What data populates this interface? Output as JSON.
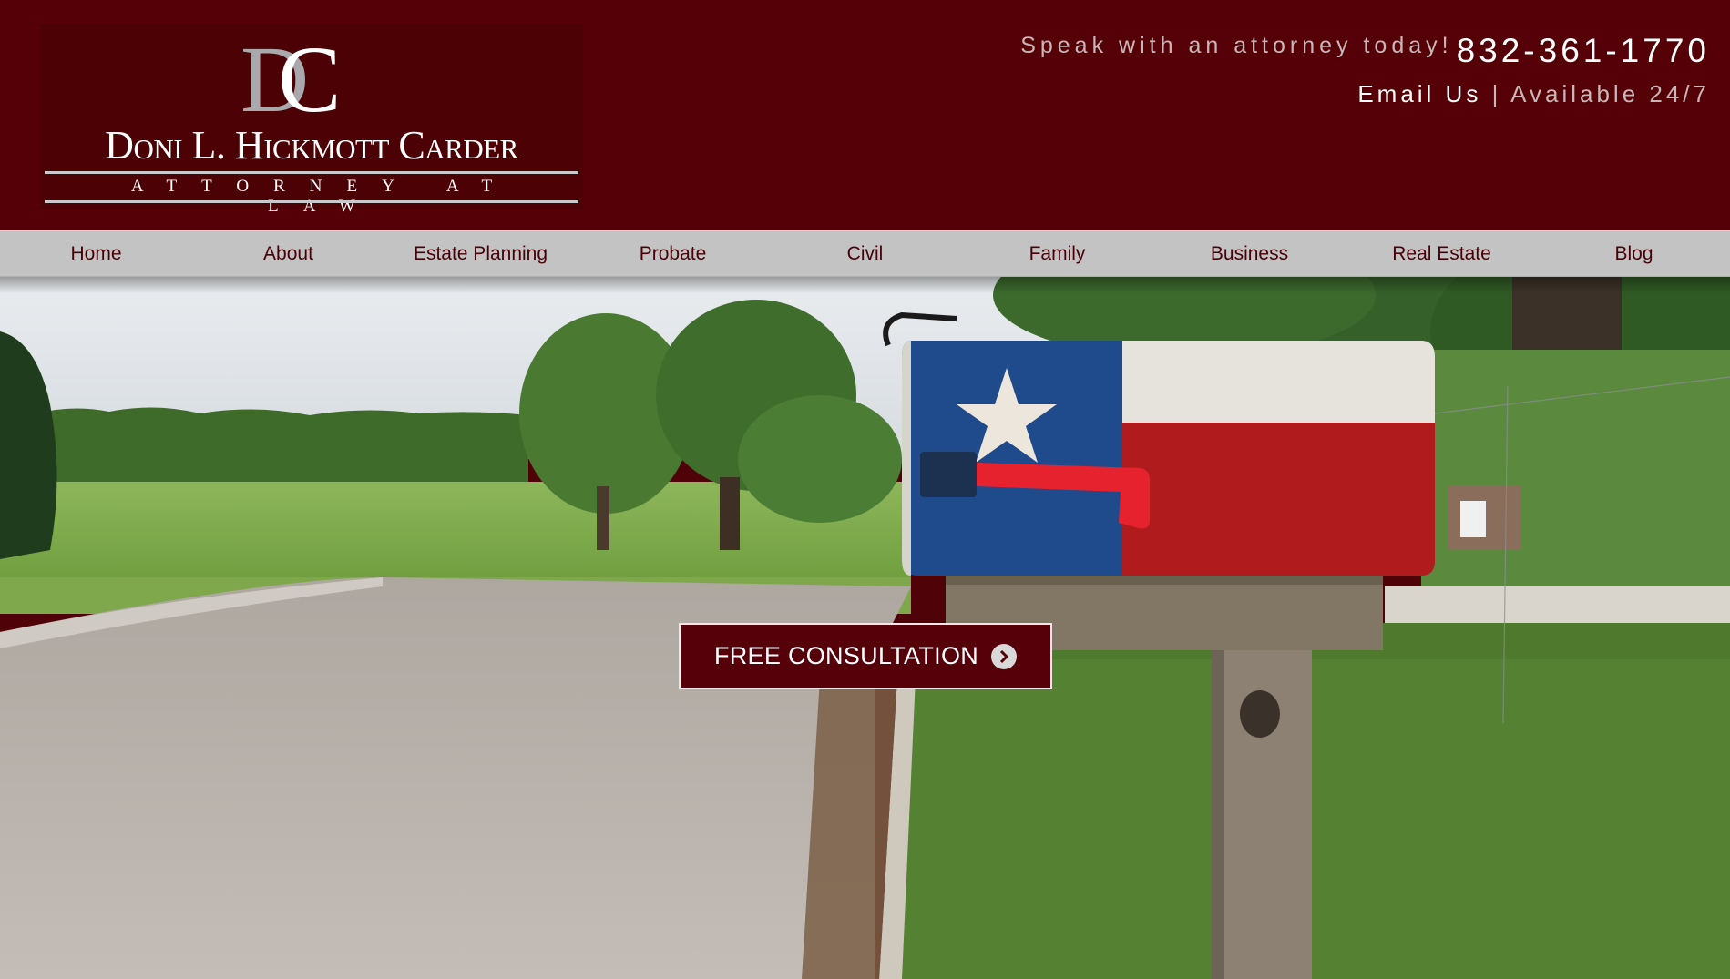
{
  "header": {
    "logo": {
      "monogram_left": "D",
      "monogram_right": "C",
      "name": "Doni L. Hickmott Carder",
      "subtitle": "ATTORNEY AT LAW"
    },
    "contact": {
      "tagline": "Speak with an attorney today!",
      "phone": "832-361-1770",
      "email_label": "Email Us",
      "separator": "|",
      "availability": "Available 24/7"
    }
  },
  "nav": {
    "items": [
      {
        "label": "Home"
      },
      {
        "label": "About"
      },
      {
        "label": "Estate Planning"
      },
      {
        "label": "Probate"
      },
      {
        "label": "Civil"
      },
      {
        "label": "Family"
      },
      {
        "label": "Business"
      },
      {
        "label": "Real Estate"
      },
      {
        "label": "Blog"
      }
    ]
  },
  "hero": {
    "cta_label": "FREE CONSULTATION",
    "cta_icon": "chevron-right-circle-icon"
  },
  "colors": {
    "brand": "#550006",
    "nav_bg": "#c3c3c3",
    "nav_text": "#4a0008"
  }
}
